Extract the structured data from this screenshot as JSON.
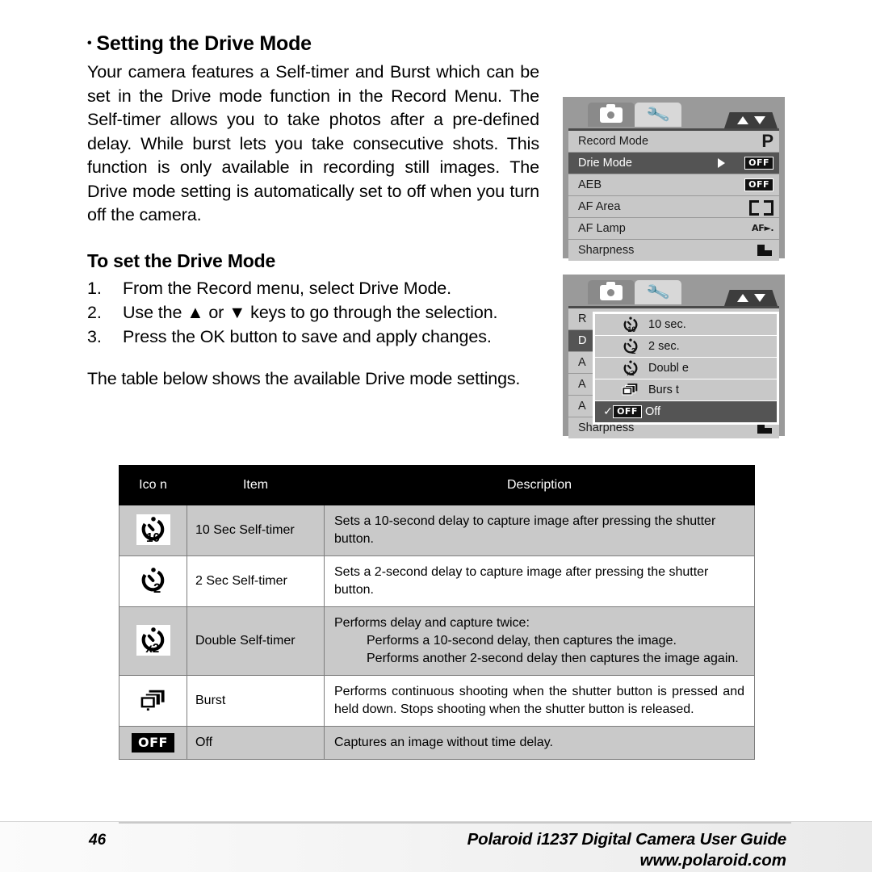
{
  "section": {
    "bullet": "•",
    "title": "Setting the Drive Mode",
    "intro": "Your camera features a Self-timer and Burst which can be set in the Drive mode function in the Record Menu. The Self-timer allows you to take photos after a pre-defined delay. While burst lets you take consecutive shots. This function is only available in recording still images. The Drive mode setting is automatically set to off when you turn off the camera.",
    "subhead": "To set the Drive Mode",
    "steps": [
      {
        "num": "1.",
        "text": "From the Record menu, select Drive Mode."
      },
      {
        "num": "2.",
        "text": "Use the ▲ or ▼ keys to go through the selection."
      },
      {
        "num": "3.",
        "text": "Press the OK button to save and apply changes."
      }
    ],
    "table_lead": "The table below shows the available Drive mode settings."
  },
  "lcd_menu": {
    "tab_camera_icon": "camera-icon",
    "tab_tool_icon": "wrench-icon",
    "scroll_indicator": "up-down-arrows-icon",
    "rows": [
      {
        "label": "Record Mode",
        "value_icon": "mode-p",
        "value_text": "P",
        "selected": false,
        "arrow": false
      },
      {
        "label": "Drie Mode",
        "value_icon": "off-badge",
        "value_text": "OFF",
        "selected": true,
        "arrow": true
      },
      {
        "label": "AEB",
        "value_icon": "off-badge",
        "value_text": "OFF",
        "selected": false,
        "arrow": false
      },
      {
        "label": "AF Area",
        "value_icon": "af-area-brackets",
        "value_text": "",
        "selected": false,
        "arrow": false
      },
      {
        "label": "AF Lamp",
        "value_icon": "af-lamp",
        "value_text": "AF",
        "selected": false,
        "arrow": false
      },
      {
        "label": "Sharpness",
        "value_icon": "sharpness",
        "value_text": "",
        "selected": false,
        "arrow": false
      }
    ]
  },
  "lcd_dropdown": {
    "background_row_labels": [
      "R",
      "D",
      "A",
      "A",
      "A"
    ],
    "bottom_row_label": "Sharpness",
    "options": [
      {
        "icon": "timer-10sec-icon",
        "label": "10 sec.",
        "selected": false,
        "check": ""
      },
      {
        "icon": "timer-2sec-icon",
        "label": "2 sec.",
        "selected": false,
        "check": ""
      },
      {
        "icon": "timer-double-icon",
        "label": "Doubl e",
        "selected": false,
        "check": ""
      },
      {
        "icon": "burst-icon",
        "label": "Burs t",
        "selected": false,
        "check": ""
      },
      {
        "icon": "off-badge-icon",
        "label": "Off",
        "selected": true,
        "check": "✓"
      }
    ]
  },
  "table": {
    "headers": [
      "Ico n",
      "Item",
      "Description"
    ],
    "rows": [
      {
        "icon": "timer-10sec-icon",
        "item": "10 Sec Self-timer",
        "desc_main": "Sets a 10-second delay to capture image after pressing the shutter button.",
        "desc_subs": [],
        "shade": "gray"
      },
      {
        "icon": "timer-2sec-icon",
        "item": "2 Sec Self-timer",
        "desc_main": "Sets a 2-second delay to capture image after pressing the shutter button.",
        "desc_subs": [],
        "shade": "white"
      },
      {
        "icon": "timer-double-icon",
        "item": "Double Self-timer",
        "desc_main": "Performs delay and capture twice:",
        "desc_subs": [
          "Performs a 10-second delay, then captures the image.",
          "Performs another 2-second delay then captures the image again."
        ],
        "shade": "gray"
      },
      {
        "icon": "burst-icon",
        "item": "Burst",
        "desc_main": "Performs continuous shooting when the shutter button is pressed and held down. Stops shooting when the shutter button is released.",
        "desc_subs": [],
        "shade": "white"
      },
      {
        "icon": "off-badge-icon",
        "item": "Off",
        "desc_main": "Captures an image without time delay.",
        "desc_subs": [],
        "shade": "gray"
      }
    ]
  },
  "footer": {
    "page_number": "46",
    "guide_title": "Polaroid i1237 Digital Camera User Guide",
    "url": "www.polaroid.com"
  },
  "colors": {
    "header_bg": "#000000",
    "row_gray": "#c9c9c9",
    "lcd_bg": "#9a9a9a",
    "lcd_row": "#c8c8c8",
    "lcd_selected": "#545454"
  }
}
